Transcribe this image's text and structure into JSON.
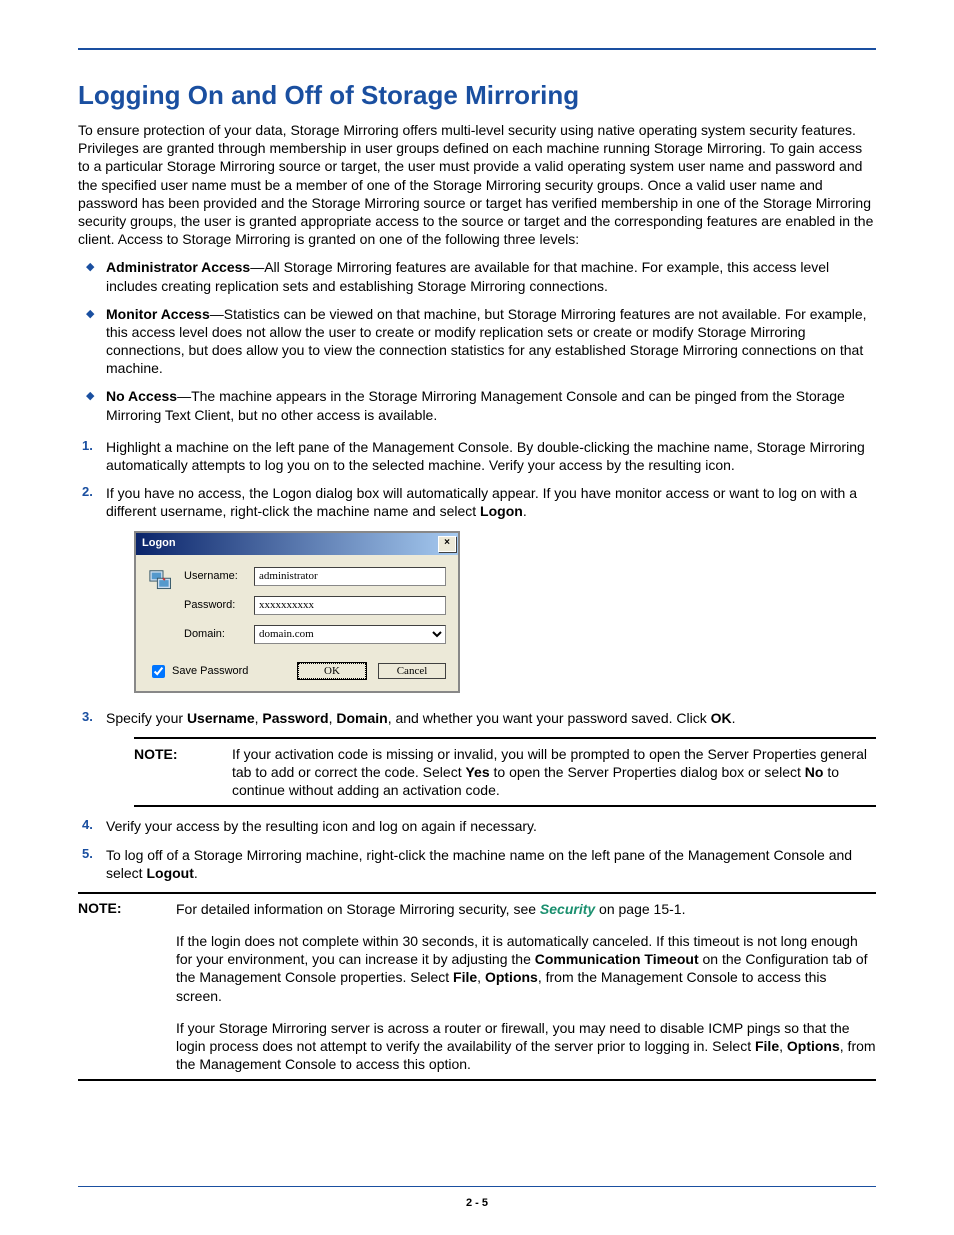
{
  "page_number": "2 - 5",
  "heading": "Logging On and Off of Storage Mirroring",
  "intro": "To ensure protection of your data, Storage Mirroring offers multi-level security using native operating system security features. Privileges are granted through membership in user groups defined on each machine running Storage Mirroring. To gain access to a particular Storage Mirroring source or target, the user must provide a valid operating system user name and password and the specified user name must be a member of one of the Storage Mirroring security groups. Once a valid user name and password has been provided and the Storage Mirroring source or target has verified membership in one of the Storage Mirroring security groups, the user is granted appropriate access to the source or target and the corresponding features are enabled in the client. Access to Storage Mirroring is granted on one of the following three levels:",
  "access_levels": [
    {
      "title": "Administrator Access",
      "desc": "—All Storage Mirroring features are available for that machine. For example, this access level includes creating replication sets and establishing Storage Mirroring connections."
    },
    {
      "title": "Monitor Access",
      "desc": "—Statistics can be viewed on that machine, but Storage Mirroring features are not available.  For example, this access level does not allow the user to create or modify replication sets or create or modify Storage Mirroring connections, but does allow you to view the connection statistics for any established Storage Mirroring connections on that machine."
    },
    {
      "title": "No Access",
      "desc": "—The machine appears in the Storage Mirroring Management Console and can be pinged from the Storage Mirroring Text Client, but no other access is available."
    }
  ],
  "step1": "Highlight a machine on the left pane of the Management Console. By double-clicking the machine name, Storage Mirroring automatically attempts to log you on to the selected machine. Verify your access by the resulting icon.",
  "step2": {
    "pre": "If you have no access, the Logon dialog box will automatically appear. If you have monitor access or want to log on with a different username, right-click the machine name and select ",
    "logon_bold": "Logon",
    "post": "."
  },
  "dialog": {
    "title": "Logon",
    "username_label": "Username:",
    "password_label": "Password:",
    "domain_label": "Domain:",
    "username_value": "administrator",
    "password_value": "xxxxxxxxxx",
    "domain_value": "domain.com",
    "save_password_label": "Save Password",
    "ok_label": "OK",
    "cancel_label": "Cancel"
  },
  "step3": {
    "pre": "Specify your ",
    "b1": "Username",
    "s1": ", ",
    "b2": "Password",
    "s2": ", ",
    "b3": "Domain",
    "s3": ", and whether you want your password saved. Click ",
    "b4": "OK",
    "post": "."
  },
  "note1": {
    "label": "NOTE:",
    "p1_pre": "If your activation code is missing or invalid, you will be prompted to open the Server Properties general tab to add or correct the code. Select ",
    "yes": "Yes",
    "p1_mid": " to open the Server Properties dialog box or select ",
    "no": "No",
    "p1_post": " to continue without adding an activation code."
  },
  "step4": "Verify your access by the resulting icon and log on again if necessary.",
  "step5": {
    "pre": "To log off of a Storage Mirroring machine, right-click the machine name on the left pane of the Management Console and select ",
    "logout_bold": "Logout",
    "post": "."
  },
  "note2": {
    "label": "NOTE:",
    "p1_pre": "For detailed information on Storage Mirroring security, see ",
    "link_text": "Security",
    "p1_post": " on page 15-1.",
    "p2_pre": "If the login does not complete within 30 seconds, it is automatically canceled. If this timeout is not long enough for your environment, you can increase it by adjusting the ",
    "p2_b1": "Communication Timeout",
    "p2_mid1": " on the Configuration tab of the Management Console properties. Select ",
    "p2_b2": "File",
    "p2_mid2": ", ",
    "p2_b3": "Options",
    "p2_post": ", from the Management Console to access this screen.",
    "p3_pre": "If your Storage Mirroring server is across a router or firewall, you may need to disable ICMP pings so that the login process does not attempt to verify the availability of the server prior to logging in. Select  ",
    "p3_b1": "File",
    "p3_mid": ", ",
    "p3_b2": "Options",
    "p3_post": ", from the Management Console to access this option."
  }
}
